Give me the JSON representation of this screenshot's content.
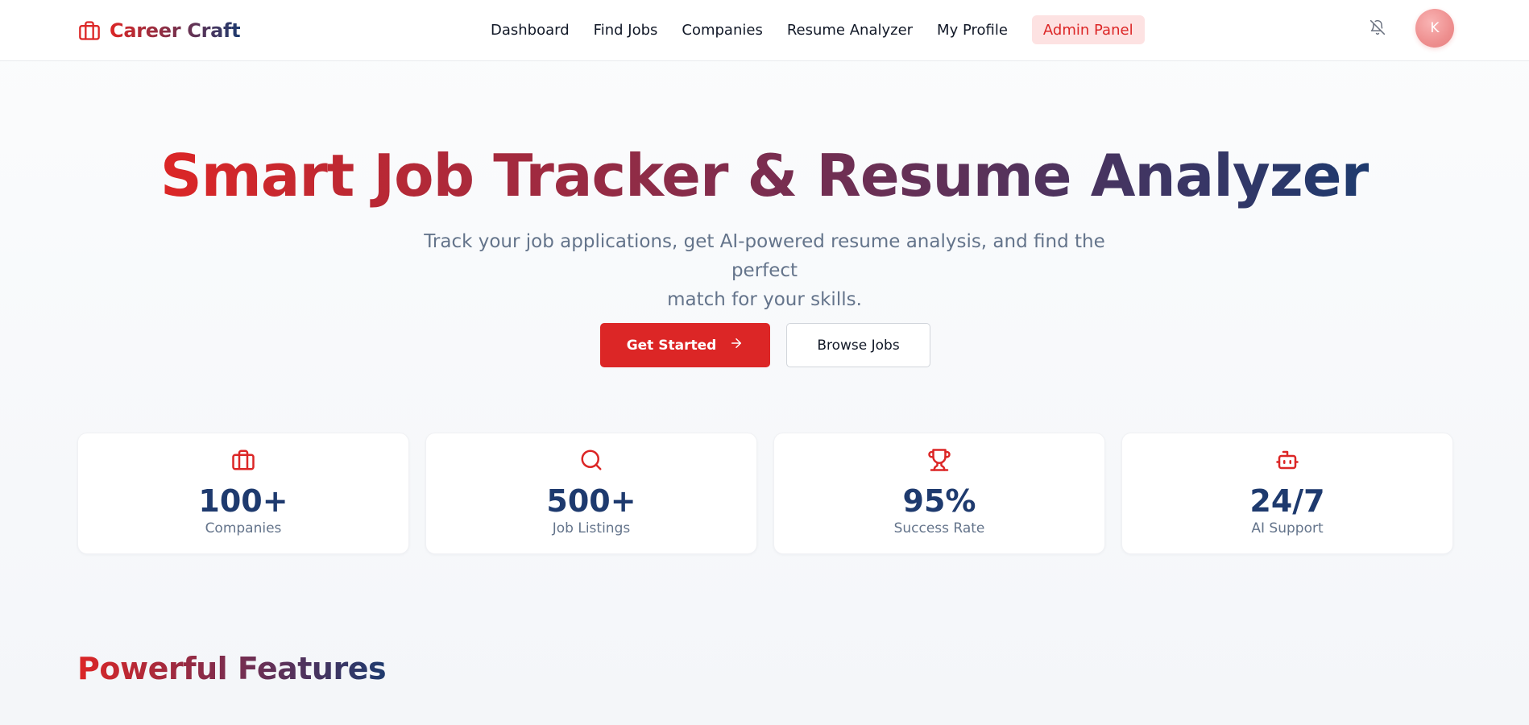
{
  "brand": {
    "name": "Career Craft",
    "icon": "briefcase-icon"
  },
  "nav": {
    "links": [
      "Dashboard",
      "Find Jobs",
      "Companies",
      "Resume Analyzer",
      "My Profile"
    ],
    "admin": "Admin Panel",
    "notification_icon": "bell-off-icon",
    "avatar_initial": "K"
  },
  "hero": {
    "title": "Smart Job Tracker & Resume Analyzer",
    "subtitle_line1": "Track your job applications, get AI-powered resume analysis, and find the perfect",
    "subtitle_line2": "match for your skills.",
    "primary_button": "Get Started",
    "primary_button_icon": "arrow-right-icon",
    "secondary_button": "Browse Jobs"
  },
  "stats": [
    {
      "icon": "briefcase-icon",
      "value": "100+",
      "label": "Companies"
    },
    {
      "icon": "search-icon",
      "value": "500+",
      "label": "Job Listings"
    },
    {
      "icon": "trophy-icon",
      "value": "95%",
      "label": "Success Rate"
    },
    {
      "icon": "bot-icon",
      "value": "24/7",
      "label": "AI Support"
    }
  ],
  "features": {
    "title": "Powerful Features"
  },
  "colors": {
    "accent": "#dc2626",
    "navy": "#1e3a6e",
    "admin_bg": "#fde2e2",
    "muted_text": "#64748b"
  }
}
